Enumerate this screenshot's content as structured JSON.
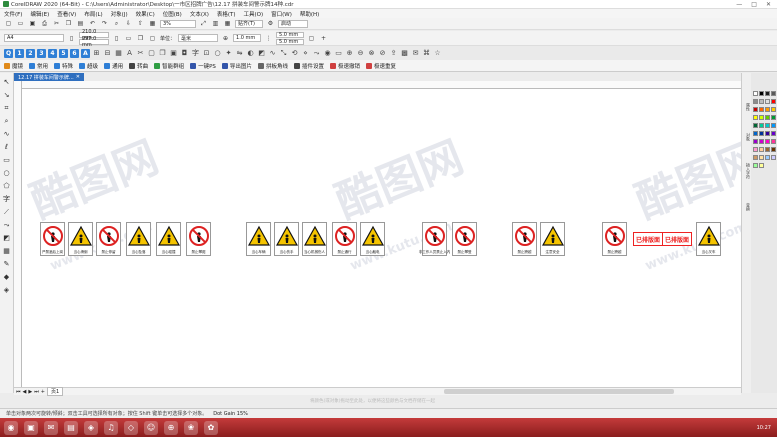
{
  "window": {
    "title": "CorelDRAW 2020 (64-Bit) - C:\\Users\\Administrator\\Desktop\\一市区招牌广告\\12.17 拼装车间警示牌14种.cdr",
    "controls": [
      "—",
      "□",
      "✕"
    ]
  },
  "menu": [
    "文件(F)",
    "编辑(E)",
    "查看(V)",
    "布局(L)",
    "对象(J)",
    "效果(C)",
    "位图(B)",
    "文本(X)",
    "表格(T)",
    "工具(O)",
    "窗口(W)",
    "帮助(H)"
  ],
  "toolbar": {
    "zoom": "3%",
    "snap": "贴齐(T)",
    "launch": "启动"
  },
  "property_bar": {
    "page_size": "A4",
    "width": "210.0 mm",
    "height": "297.0 mm",
    "units_label": "单位：",
    "units": "毫米",
    "nudge": "1.0 mm",
    "dup_x": "5.0 mm",
    "dup_y": "5.0 mm"
  },
  "plugin_numbers": [
    "Q",
    "1",
    "2",
    "3",
    "4",
    "5",
    "6",
    "A"
  ],
  "plugin_bar2": [
    {
      "label": "魔镜",
      "color": "#e08a1a"
    },
    {
      "label": "常用",
      "color": "#2f7fd6"
    },
    {
      "label": "特殊",
      "color": "#2f7fd6"
    },
    {
      "label": "超级",
      "color": "#2f7fd6"
    },
    {
      "label": "通用",
      "color": "#2f7fd6"
    },
    {
      "label": "转曲",
      "color": "#444444"
    },
    {
      "label": "智能群组",
      "color": "#2f9e44"
    },
    {
      "label": "一键PS",
      "color": "#3355aa"
    },
    {
      "label": "导出图片",
      "color": "#3355aa"
    },
    {
      "label": "拼板角线",
      "color": "#666666"
    },
    {
      "label": "插件设置",
      "color": "#444444"
    },
    {
      "label": "极速撤销",
      "color": "#d04040"
    },
    {
      "label": "极速重复",
      "color": "#d04040"
    }
  ],
  "document_tab": "12.17 拼装车间警示牌...",
  "signs": [
    {
      "caption": "严禁酒后上岗",
      "type": "prohibit"
    },
    {
      "caption": "当心滑倒",
      "type": "warning"
    },
    {
      "caption": "禁止停留",
      "type": "prohibit"
    },
    {
      "caption": "当心坠落",
      "type": "warning"
    },
    {
      "caption": "当心碰撞",
      "type": "warning"
    },
    {
      "caption": "禁止攀爬",
      "type": "prohibit"
    },
    {
      "caption": "当心车辆",
      "type": "warning"
    },
    {
      "caption": "当心伤手",
      "type": "warning"
    },
    {
      "caption": "当心机械伤人",
      "type": "warning"
    },
    {
      "caption": "禁止通行",
      "type": "prohibit"
    },
    {
      "caption": "当心触电",
      "type": "warning"
    },
    {
      "caption": "非工作人员禁止入内",
      "type": "prohibit"
    },
    {
      "caption": "禁止攀登",
      "type": "prohibit"
    },
    {
      "caption": "禁止跨越",
      "type": "prohibit"
    },
    {
      "caption": "注意安全",
      "type": "warning"
    },
    {
      "caption": "禁止跨越",
      "type": "prohibit"
    },
    {
      "caption": "当心叉车",
      "type": "warning"
    }
  ],
  "stickers": [
    "已排版面",
    "已排版面"
  ],
  "watermark": {
    "text": "酷图网",
    "url": "www.kutu.com"
  },
  "right_dock_tabs": [
    "属性",
    "对象",
    "插入字符",
    "变换"
  ],
  "page_tab": "页1",
  "hint_text": "将颜色(或对象)拖动至此处，以便将这些颜色与文档存储在一起",
  "status": {
    "text": "单击对象两次可旋转/倾斜；双击工具可选择所有对象；按住 Shift 键单击可选择多个对象。",
    "dot_gain": "Dot Gain 15%"
  },
  "palette_colors": [
    "#ffffff",
    "#000000",
    "#1b1b1b",
    "#5a5a5a",
    "#8c8c8c",
    "#bdbdbd",
    "#e0e0e0",
    "#ff0000",
    "#c80000",
    "#ff6600",
    "#ff9900",
    "#ffcc00",
    "#ffff00",
    "#ccff00",
    "#66cc00",
    "#009933",
    "#006633",
    "#00cc99",
    "#00cccc",
    "#0099ff",
    "#0066cc",
    "#003399",
    "#330099",
    "#6600cc",
    "#9900cc",
    "#cc00cc",
    "#ff00cc",
    "#ff3399",
    "#ff99cc",
    "#ffcc99",
    "#996633",
    "#663300",
    "#cc9966",
    "#ffe0a0",
    "#99ccff",
    "#ccccff",
    "#99ff99",
    "#ffff99"
  ],
  "taskbar": [
    "◉",
    "▣",
    "✉",
    "▤",
    "◈",
    "♫",
    "◇",
    "☺",
    "⊕",
    "❀",
    "✿"
  ],
  "clock": "10:27"
}
